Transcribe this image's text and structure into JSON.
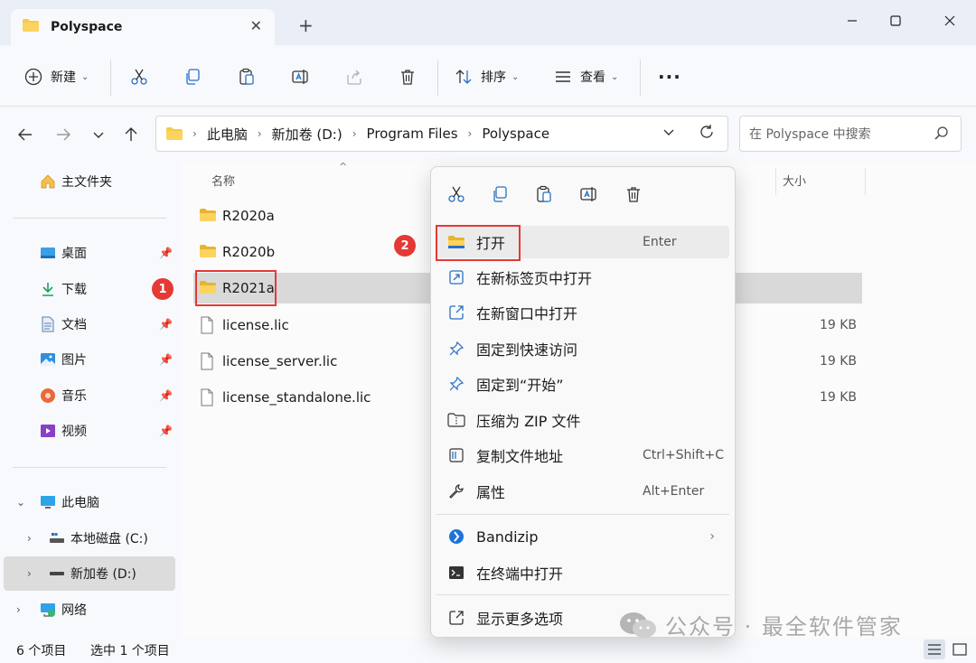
{
  "titlebar": {
    "tab_label": "Polyspace",
    "tab_close": "✕",
    "new_tab": "+",
    "minimize": "—",
    "maximize": "▢",
    "close": "✕"
  },
  "toolbar": {
    "new_label": "新建",
    "sort_label": "排序",
    "view_label": "查看",
    "more_label": "···"
  },
  "address": {
    "crumbs": [
      "此电脑",
      "新加卷 (D:)",
      "Program Files",
      "Polyspace"
    ],
    "search_placeholder": "在 Polyspace 中搜索"
  },
  "sidebar": {
    "home": "主文件夹",
    "quick": [
      "桌面",
      "下载",
      "文档",
      "图片",
      "音乐",
      "视频"
    ],
    "this_pc": "此电脑",
    "drive_c": "本地磁盘 (C:)",
    "drive_d": "新加卷 (D:)",
    "network": "网络"
  },
  "columns": {
    "name": "名称",
    "size": "大小"
  },
  "files": [
    {
      "name": "R2020a",
      "size": ""
    },
    {
      "name": "R2020b",
      "size": ""
    },
    {
      "name": "R2021a",
      "size": ""
    },
    {
      "name": "license.lic",
      "size": "19 KB"
    },
    {
      "name": "license_server.lic",
      "size": "19 KB"
    },
    {
      "name": "license_standalone.lic",
      "size": "19 KB"
    }
  ],
  "status": {
    "count": "6 个项目",
    "selected": "选中 1 个项目"
  },
  "badges": {
    "one": "1",
    "two": "2"
  },
  "context_menu": {
    "items": [
      {
        "label": "打开",
        "shortcut": "Enter"
      },
      {
        "label": "在新标签页中打开",
        "shortcut": ""
      },
      {
        "label": "在新窗口中打开",
        "shortcut": ""
      },
      {
        "label": "固定到快速访问",
        "shortcut": ""
      },
      {
        "label": "固定到“开始”",
        "shortcut": ""
      },
      {
        "label": "压缩为 ZIP 文件",
        "shortcut": ""
      },
      {
        "label": "复制文件地址",
        "shortcut": "Ctrl+Shift+C"
      },
      {
        "label": "属性",
        "shortcut": "Alt+Enter"
      },
      {
        "label": "Bandizip",
        "shortcut": ""
      },
      {
        "label": "在终端中打开",
        "shortcut": ""
      },
      {
        "label": "显示更多选项",
        "shortcut": ""
      }
    ]
  },
  "watermark": {
    "text": "公众号 · 最全软件管家"
  },
  "colors": {
    "accent": "#0067c0",
    "folder": "#f8c94a",
    "marker": "#e53935"
  }
}
